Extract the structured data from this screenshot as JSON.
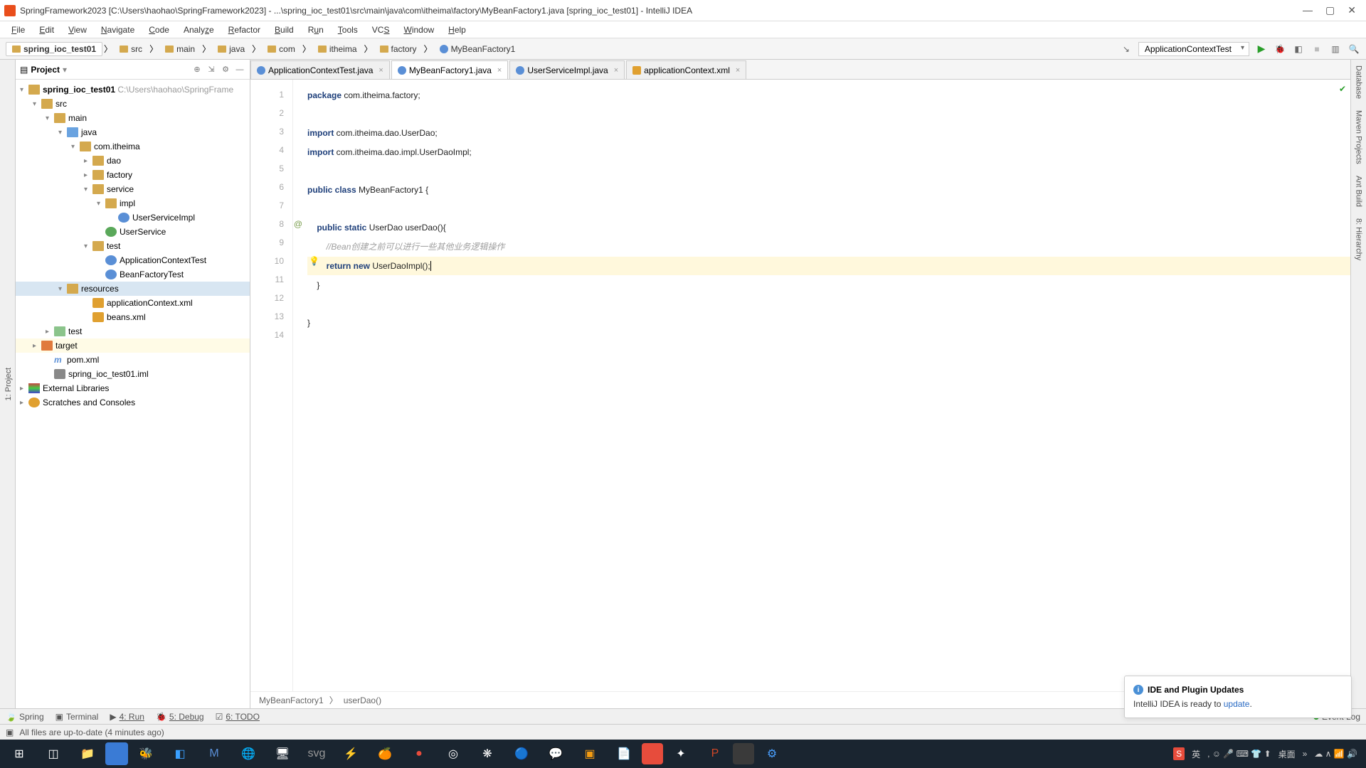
{
  "window": {
    "title": "SpringFramework2023 [C:\\Users\\haohao\\SpringFramework2023] - ...\\spring_ioc_test01\\src\\main\\java\\com\\itheima\\factory\\MyBeanFactory1.java [spring_ioc_test01] - IntelliJ IDEA"
  },
  "menu": [
    "File",
    "Edit",
    "View",
    "Navigate",
    "Code",
    "Analyze",
    "Refactor",
    "Build",
    "Run",
    "Tools",
    "VCS",
    "Window",
    "Help"
  ],
  "breadcrumbs": [
    "spring_ioc_test01",
    "src",
    "main",
    "java",
    "com",
    "itheima",
    "factory",
    "MyBeanFactory1"
  ],
  "runconfig": "ApplicationContextTest",
  "project_panel": {
    "title": "Project"
  },
  "tree": {
    "root": "spring_ioc_test01",
    "root_path": "C:\\Users\\haohao\\SpringFrame",
    "src": "src",
    "main": "main",
    "java": "java",
    "pkg": "com.itheima",
    "dao": "dao",
    "factory": "factory",
    "service": "service",
    "impl": "impl",
    "usi": "UserServiceImpl",
    "us": "UserService",
    "test": "test",
    "act": "ApplicationContextTest",
    "bft": "BeanFactoryTest",
    "resources": "resources",
    "appctx": "applicationContext.xml",
    "beans": "beans.xml",
    "testdir": "test",
    "target": "target",
    "pom": "pom.xml",
    "iml": "spring_ioc_test01.iml",
    "extlib": "External Libraries",
    "scratch": "Scratches and Consoles"
  },
  "tabs": [
    {
      "label": "ApplicationContextTest.java",
      "active": false
    },
    {
      "label": "MyBeanFactory1.java",
      "active": true
    },
    {
      "label": "UserServiceImpl.java",
      "active": false
    },
    {
      "label": "applicationContext.xml",
      "active": false
    }
  ],
  "code": {
    "l1a": "package",
    "l1b": " com.itheima.factory;",
    "l3a": "import",
    "l3b": " com.itheima.dao.UserDao;",
    "l4a": "import",
    "l4b": " com.itheima.dao.impl.UserDaoImpl;",
    "l6a": "public class",
    "l6b": " MyBeanFactory1 {",
    "l8a": "    public static",
    "l8b": " UserDao userDao(){",
    "l9": "        //Bean创建之前可以进行一些其他业务逻辑操作",
    "l10a": "        return new",
    "l10b": " UserDaoImpl();",
    "l11": "    }",
    "l13": "}"
  },
  "gutter": [
    "1",
    "2",
    "3",
    "4",
    "5",
    "6",
    "7",
    "8",
    "9",
    "10",
    "11",
    "12",
    "13",
    "14"
  ],
  "bottom_crumb": {
    "a": "MyBeanFactory1",
    "b": "userDao()"
  },
  "notif": {
    "title": "IDE and Plugin Updates",
    "body": "IntelliJ IDEA is ready to ",
    "link": "update",
    "period": "."
  },
  "bottom_tabs": {
    "spring": "Spring",
    "terminal": "Terminal",
    "run": "4: Run",
    "debug": "5: Debug",
    "todo": "6: TODO",
    "eventlog": "Event Log"
  },
  "status": "All files are up-to-date (4 minutes ago)",
  "tray": {
    "lang": "英",
    "desktop": "桌面"
  }
}
